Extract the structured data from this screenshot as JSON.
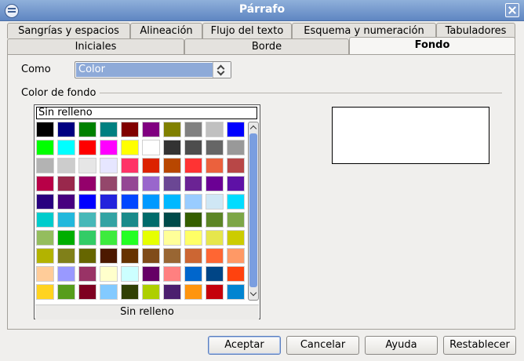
{
  "window": {
    "title": "Párrafo"
  },
  "tabs_row1": [
    "Sangrías y espacios",
    "Alineación",
    "Flujo del texto",
    "Esquema y numeración",
    "Tabuladores"
  ],
  "tabs_row2": [
    "Iniciales",
    "Borde",
    "Fondo"
  ],
  "active_tab": "Fondo",
  "como": {
    "label": "Como",
    "value": "Color"
  },
  "section": {
    "label": "Color de fondo"
  },
  "palette": {
    "no_fill_label": "Sin relleno",
    "selected_label": "Sin relleno",
    "colors": [
      [
        "#000000",
        "#000080",
        "#008000",
        "#008080",
        "#800000",
        "#800080",
        "#808000",
        "#808080",
        "#c0c0c0",
        "#0000ff"
      ],
      [
        "#00ff00",
        "#00ffff",
        "#ff0000",
        "#ff00ff",
        "#ffff00",
        "#ffffff",
        "#333333",
        "#4d4d4d",
        "#666666",
        "#999999"
      ],
      [
        "#b3b3b3",
        "#cccccc",
        "#e6e6e6",
        "#e6e6ff",
        "#ff3366",
        "#dc2300",
        "#b84700",
        "#ff3333",
        "#eb613d",
        "#b84747"
      ],
      [
        "#b80047",
        "#99284c",
        "#94006b",
        "#94476b",
        "#944794",
        "#9966cc",
        "#6b4794",
        "#6b2394",
        "#6b0094",
        "#5e11a6"
      ],
      [
        "#28007f",
        "#47007f",
        "#0000ff",
        "#2323dc",
        "#0047ff",
        "#0099ff",
        "#00b8ff",
        "#99ccff",
        "#cfe7f5",
        "#00dcff"
      ],
      [
        "#00cccc",
        "#23b8dc",
        "#47b8b8",
        "#33a3a3",
        "#198a8a",
        "#006b6b",
        "#004a4a",
        "#355e00",
        "#5c8526",
        "#7da647"
      ],
      [
        "#94bd5e",
        "#00ae00",
        "#33cc66",
        "#3deb3d",
        "#23ff23",
        "#e6ff00",
        "#ffff99",
        "#ffff66",
        "#e6e64c",
        "#cccc00"
      ],
      [
        "#b3b300",
        "#808019",
        "#666600",
        "#4c1900",
        "#663300",
        "#804c19",
        "#996633",
        "#cc6633",
        "#ff6633",
        "#ff9966"
      ],
      [
        "#ffcc99",
        "#9999ff",
        "#993366",
        "#ffffcc",
        "#ccffff",
        "#660066",
        "#ff8080",
        "#0066cc",
        "#004586",
        "#ff420e"
      ],
      [
        "#ffd320",
        "#579d1c",
        "#7e0021",
        "#83caff",
        "#314004",
        "#aecf00",
        "#4b1f6f",
        "#ff950e",
        "#c5000b",
        "#0084d1"
      ]
    ]
  },
  "buttons": {
    "ok": "Aceptar",
    "cancel": "Cancelar",
    "help": "Ayuda",
    "reset": "Restablecer"
  },
  "icons": {
    "window": "app-icon",
    "close": "close-icon"
  }
}
